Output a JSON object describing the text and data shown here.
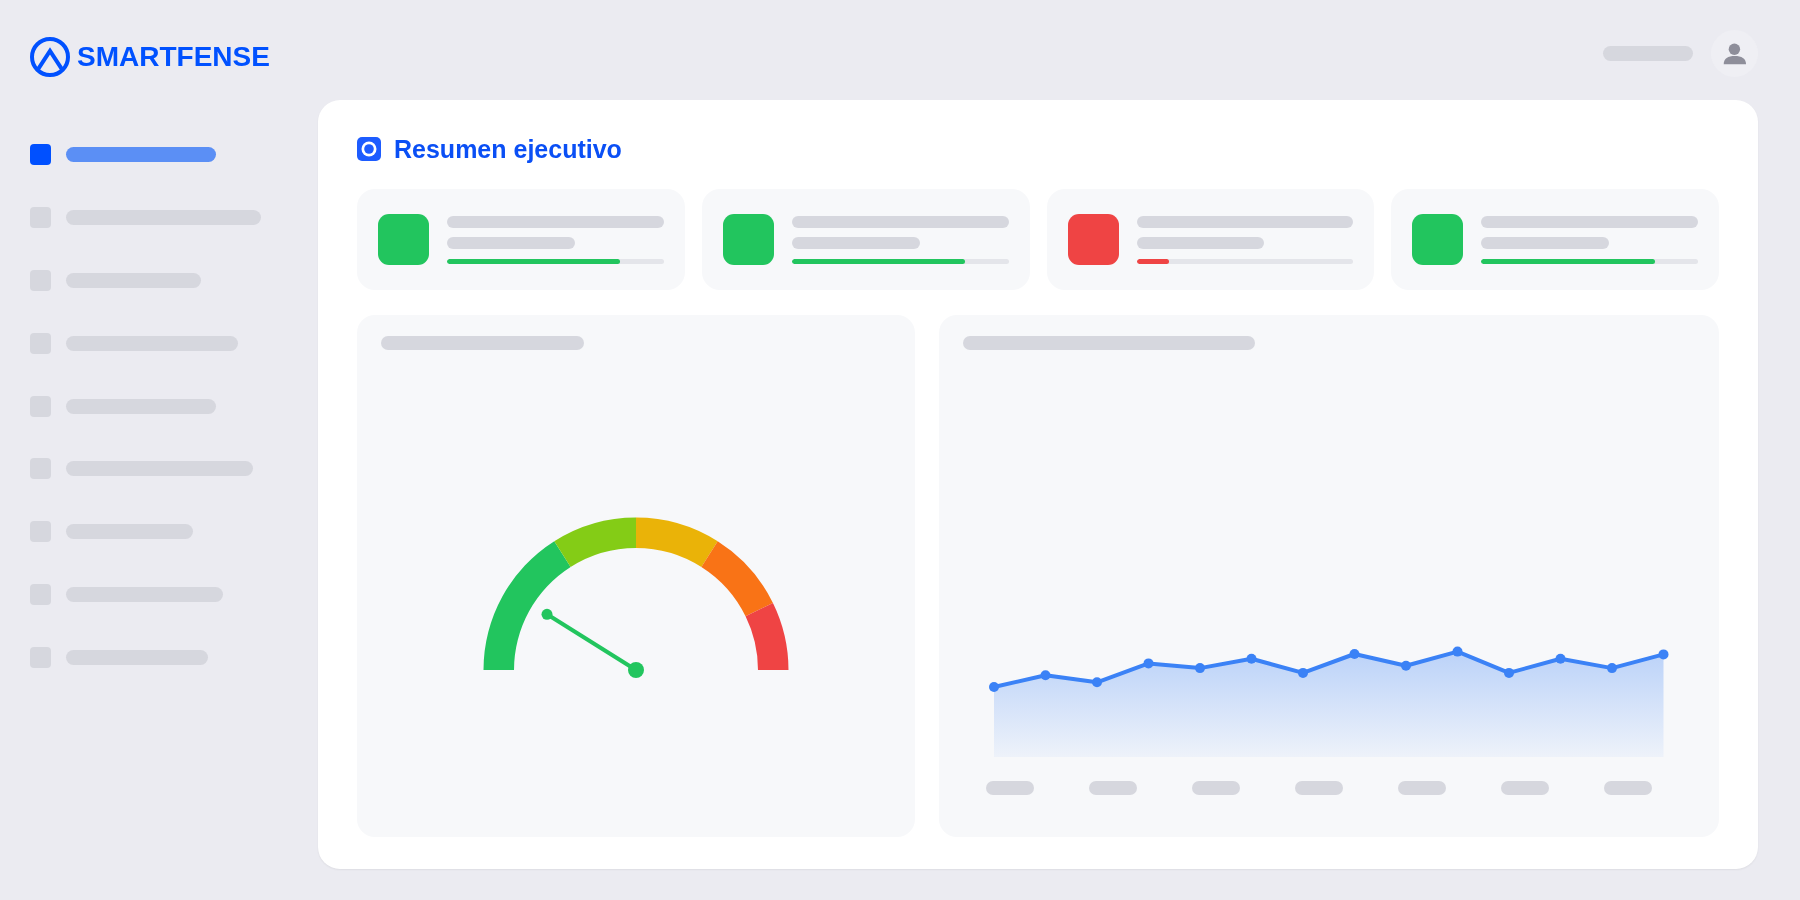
{
  "brand": {
    "name": "SMARTFENSE"
  },
  "sidebar": {
    "items": [
      {
        "selected": true
      },
      {
        "selected": false
      },
      {
        "selected": false
      },
      {
        "selected": false
      },
      {
        "selected": false
      },
      {
        "selected": false
      },
      {
        "selected": false
      },
      {
        "selected": false
      },
      {
        "selected": false
      }
    ]
  },
  "page": {
    "title": "Resumen ejecutivo"
  },
  "stat_cards": [
    {
      "color": "#22c55e",
      "level": 0.8
    },
    {
      "color": "#22c55e",
      "level": 0.8
    },
    {
      "color": "#ef4444",
      "level": 0.15
    },
    {
      "color": "#22c55e",
      "level": 0.8
    }
  ],
  "panels": [
    {
      "kind": "gauge",
      "segments": [
        {
          "color": "#22c55e"
        },
        {
          "color": "#84cc16"
        },
        {
          "color": "#eab308"
        },
        {
          "color": "#f97316"
        },
        {
          "color": "#ef4444"
        }
      ]
    },
    {
      "kind": "area_chart"
    }
  ]
}
